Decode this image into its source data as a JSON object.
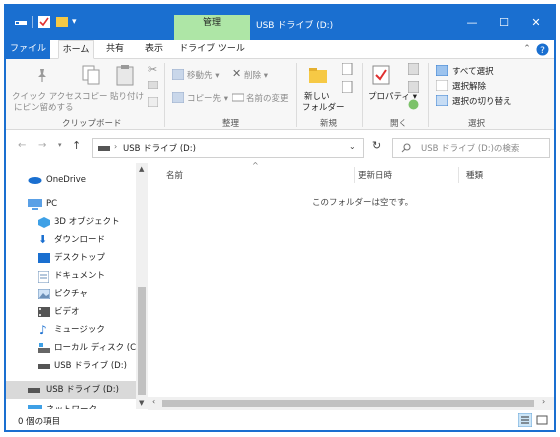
{
  "titlebar": {
    "tools_tab": "管理",
    "title": "USB ドライブ (D:)",
    "minimize": "—",
    "maximize": "☐",
    "close": "✕"
  },
  "tabs": {
    "file": "ファイル",
    "home": "ホーム",
    "share": "共有",
    "view": "表示",
    "drive_tools": "ドライブ ツール"
  },
  "ribbon": {
    "clipboard": {
      "pin_line1": "クイック アクセス",
      "pin_line2": "にピン留めする",
      "copy": "コピー",
      "paste": "貼り付け",
      "group": "クリップボード"
    },
    "organize": {
      "move_to": "移動先",
      "copy_to": "コピー先",
      "delete": "削除",
      "rename": "名前の変更",
      "group": "整理"
    },
    "new": {
      "new_folder_line1": "新しい",
      "new_folder_line2": "フォルダー",
      "group": "新規"
    },
    "open": {
      "properties": "プロパティ",
      "group": "開く"
    },
    "select": {
      "select_all": "すべて選択",
      "select_none": "選択解除",
      "invert": "選択の切り替え",
      "group": "選択"
    }
  },
  "address": {
    "path": "USB ドライブ (D:)",
    "search_placeholder": "USB ドライブ (D:)の検索"
  },
  "nav": {
    "items": [
      {
        "label": "OneDrive"
      },
      {
        "label": "PC"
      },
      {
        "label": "3D オブジェクト"
      },
      {
        "label": "ダウンロード"
      },
      {
        "label": "デスクトップ"
      },
      {
        "label": "ドキュメント"
      },
      {
        "label": "ピクチャ"
      },
      {
        "label": "ビデオ"
      },
      {
        "label": "ミュージック"
      },
      {
        "label": "ローカル ディスク (C:)"
      },
      {
        "label": "USB ドライブ (D:)"
      },
      {
        "label": "USB ドライブ (D:)"
      },
      {
        "label": "ネットワーク"
      }
    ]
  },
  "content": {
    "col_name": "名前",
    "col_date": "更新日時",
    "col_type": "種類",
    "empty_message": "このフォルダーは空です。"
  },
  "status": {
    "item_count": "0 個の項目"
  },
  "colors": {
    "accent": "#1a6fd0",
    "tools_tab": "#aee6a6"
  }
}
